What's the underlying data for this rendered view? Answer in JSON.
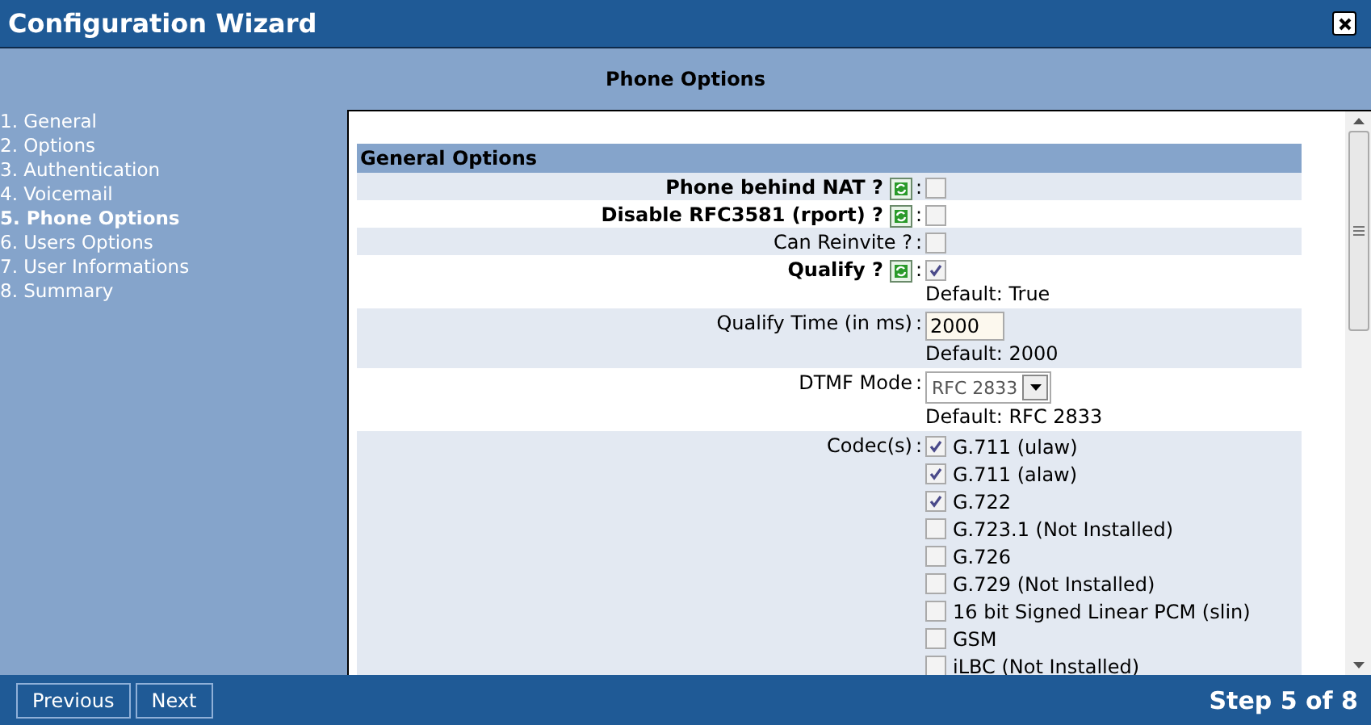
{
  "window": {
    "title": "Configuration Wizard"
  },
  "page_title": "Phone Options",
  "steps": [
    {
      "number": "1.",
      "label": "General",
      "selected": false
    },
    {
      "number": "2.",
      "label": "Options",
      "selected": false
    },
    {
      "number": "3.",
      "label": "Authentication",
      "selected": false
    },
    {
      "number": "4.",
      "label": "Voicemail",
      "selected": false
    },
    {
      "number": "5.",
      "label": "Phone Options",
      "selected": true
    },
    {
      "number": "6.",
      "label": "Users Options",
      "selected": false
    },
    {
      "number": "7.",
      "label": "User Informations",
      "selected": false
    },
    {
      "number": "8.",
      "label": "Summary",
      "selected": false
    }
  ],
  "section": {
    "title": "General Options"
  },
  "fields": [
    {
      "kind": "checkbox",
      "label": "Phone behind NAT ?",
      "bold": true,
      "help": true,
      "separator": ":",
      "checked": false
    },
    {
      "kind": "checkbox",
      "label": "Disable RFC3581 (rport) ?",
      "bold": true,
      "help": true,
      "separator": ":",
      "checked": false
    },
    {
      "kind": "checkbox",
      "label": "Can Reinvite ?",
      "bold": false,
      "help": false,
      "separator": ":",
      "checked": false
    },
    {
      "kind": "checkbox",
      "label": "Qualify ?",
      "bold": true,
      "help": true,
      "separator": ":",
      "checked": true,
      "default": "Default: True"
    },
    {
      "kind": "text",
      "label": "Qualify Time (in ms)",
      "bold": false,
      "help": false,
      "separator": ":",
      "value": "2000",
      "default": "Default: 2000"
    },
    {
      "kind": "select",
      "label": "DTMF Mode",
      "bold": false,
      "help": false,
      "separator": ":",
      "value": "RFC 2833",
      "default": "Default: RFC 2833"
    },
    {
      "kind": "checklist",
      "label": "Codec(s)",
      "bold": false,
      "help": false,
      "separator": ":",
      "options": [
        {
          "label": "G.711 (ulaw)",
          "checked": true
        },
        {
          "label": "G.711 (alaw)",
          "checked": true
        },
        {
          "label": "G.722",
          "checked": true
        },
        {
          "label": "G.723.1 (Not Installed)",
          "checked": false
        },
        {
          "label": "G.726",
          "checked": false
        },
        {
          "label": "G.729 (Not Installed)",
          "checked": false
        },
        {
          "label": "16 bit Signed Linear PCM (slin)",
          "checked": false
        },
        {
          "label": "GSM",
          "checked": false
        },
        {
          "label": "iLBC (Not Installed)",
          "checked": false
        }
      ]
    }
  ],
  "buttons": [
    {
      "label": "Previous"
    },
    {
      "label": "Next"
    }
  ],
  "step_indicator": "Step 5 of 8"
}
